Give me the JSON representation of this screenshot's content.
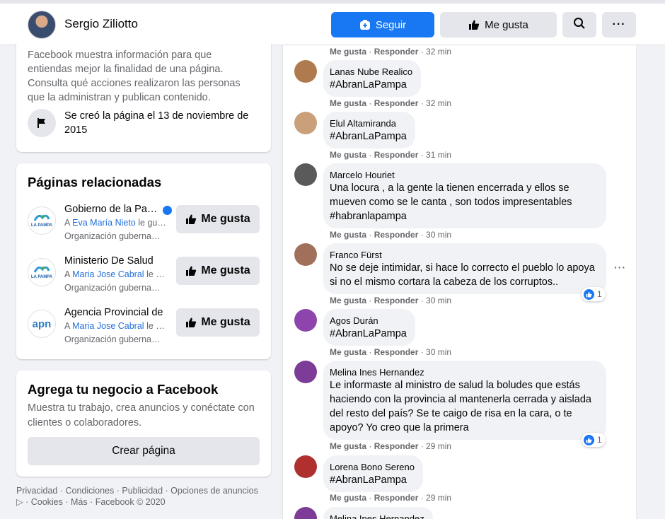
{
  "header": {
    "page_name": "Sergio Ziliotto",
    "follow_label": "Seguir",
    "like_label": "Me gusta",
    "icons": [
      "follow-icon",
      "like-icon",
      "search-icon",
      "more-icon"
    ]
  },
  "transparency": {
    "text": "Facebook muestra información para que entiendas mejor la finalidad de una página. Consulta qué acciones realizaron las personas que la administran y publican contenido.",
    "created": "Se creó la página el 13 de noviembre de 2015"
  },
  "related": {
    "title": "Páginas relacionadas",
    "like_label": "Me gusta",
    "items": [
      {
        "name": "Gobierno de la Pampa",
        "friend_prefix": "A",
        "friend": "Eva María Nieto",
        "friend_suffix": "le gusta",
        "category": "Organización gubernamental",
        "logo_text": "LA PAMPA"
      },
      {
        "name": "Ministerio De Salud",
        "friend_prefix": "A",
        "friend": "Maria Jose Cabral",
        "friend_suffix": "le gusta",
        "category": "Organización gubernamental",
        "logo_text": "LA PAMPA"
      },
      {
        "name": "Agencia Provincial de",
        "friend_prefix": "A",
        "friend": "Maria Jose Cabral",
        "friend_suffix": "le gusta",
        "category": "Organización gubernamental",
        "logo_text": "apn"
      }
    ]
  },
  "business": {
    "title": "Agrega tu negocio a Facebook",
    "desc": "Muestra tu trabajo, crea anuncios y conéctate con clientes o colaboradores.",
    "button": "Crear página"
  },
  "footer": {
    "line1": "Privacidad · Condiciones · Publicidad · Opciones de anuncios",
    "line2": "▷ · Cookies · Más · Facebook © 2020"
  },
  "comments": {
    "like": "Me gusta",
    "reply": "Responder",
    "top_time": "32 min",
    "items": [
      {
        "author": "Lanas Nube Realico",
        "text": "#AbranLaPampa",
        "time": "32 min",
        "avatar": "#b07a4f"
      },
      {
        "author": "Elul Altamiranda",
        "text": "#AbranLaPampa",
        "time": "31 min",
        "avatar": "#c9a07a"
      },
      {
        "author": "Marcelo Houriet",
        "text": "Una locura , a la gente la tienen encerrada y ellos se mueven como se le canta , son todos impresentables #habranlapampa",
        "time": "30 min",
        "avatar": "#5a5a5a"
      },
      {
        "author": "Franco Fürst",
        "text": "No se deje intimidar, si hace lo correcto el pueblo lo apoya si no el mismo cortara la cabeza de los corruptos..",
        "time": "30 min",
        "avatar": "#a0705a",
        "reactions": "1"
      },
      {
        "author": "Agos Durán",
        "text": "#AbranLaPampa",
        "time": "30 min",
        "avatar": "#8e44ad"
      },
      {
        "author": "Melina Ines Hernandez",
        "text": "Le informaste al ministro de salud la boludes que estás haciendo con la provincia al mantenerla cerrada y aislada del resto del país? Se te caigo de risa en la cara, o te apoyo? Yo creo que la primera",
        "time": "29 min",
        "avatar": "#7d3c98",
        "reactions": "1"
      },
      {
        "author": "Lorena Bono Sereno",
        "text": "#AbranLaPampa",
        "time": "29 min",
        "avatar": "#b03030"
      },
      {
        "author": "Melina Ines Hernandez",
        "text": "",
        "time": "",
        "avatar": "#7d3c98"
      }
    ]
  },
  "colors": {
    "brand": "#1877f2",
    "secondary_text": "#65676b",
    "bubble": "#f0f2f5"
  }
}
